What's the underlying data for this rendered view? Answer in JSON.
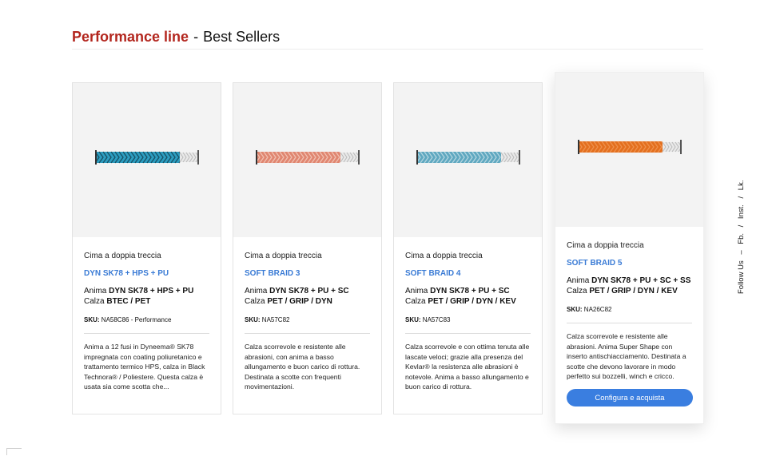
{
  "header": {
    "brand": "Performance line",
    "separator": "-",
    "subtitle": "Best Sellers"
  },
  "products": [
    {
      "type": "Cima a doppia treccia",
      "name": "DYN SK78 + HPS + PU",
      "core_label": "Anima",
      "core_value": "DYN SK78 + HPS + PU",
      "cover_label": "Calza",
      "cover_value": "BTEC / PET",
      "sku_label": "SKU:",
      "sku_value": "NA58C86 - Performance",
      "description": "Anima a 12 fusi in Dyneema® SK78 impregnata con coating poliuretanico e trattamento termico HPS, calza in Black Technora® / Poliestere. Questa calza è usata sia come scotta che...",
      "rope_color": "#2c9dc0",
      "rope_accent": "#0f2f3d"
    },
    {
      "type": "Cima a doppia treccia",
      "name": "SOFT BRAID 3",
      "core_label": "Anima",
      "core_value": "DYN SK78 + PU + SC",
      "cover_label": "Calza",
      "cover_value": "PET / GRIP / DYN",
      "sku_label": "SKU:",
      "sku_value": "NA57C82",
      "description": "Calza scorrevole e resistente alle abrasioni, con anima a basso allungamento e buon carico di rottura. Destinata a scotte con frequenti movimentazioni.",
      "rope_color": "#e08670",
      "rope_accent": "#f6d8cd"
    },
    {
      "type": "Cima a doppia treccia",
      "name": "SOFT BRAID 4",
      "core_label": "Anima",
      "core_value": "DYN SK78 + PU + SC",
      "cover_label": "Calza",
      "cover_value": "PET / GRIP / DYN / KEV",
      "sku_label": "SKU:",
      "sku_value": "NA57C83",
      "description": "Calza scorrevole e con ottima tenuta alle lascate veloci; grazie alla presenza del Kevlar® la resistenza alle abrasioni è notevole. Anima a basso allungamento e buon carico di rottura.",
      "rope_color": "#5fa8c0",
      "rope_accent": "#d7e8ee"
    },
    {
      "type": "Cima a doppia treccia",
      "name": "SOFT BRAID 5",
      "core_label": "Anima",
      "core_value": "DYN SK78 + PU + SC + SS",
      "cover_label": "Calza",
      "cover_value": "PET / GRIP / DYN / KEV",
      "sku_label": "SKU:",
      "sku_value": "NA26C82",
      "description": "Calza scorrevole e resistente alle abrasioni. Anima Super Shape con inserto antischiacciamento. Destinata a scotte che devono lavorare in modo perfetto sui bozzelli, winch e cricco.",
      "cta_label": "Configura e acquista",
      "rope_color": "#e36f1e",
      "rope_accent": "#f4a163"
    }
  ],
  "social": {
    "label": "Follow Us",
    "dash": "–",
    "fb": "Fb.",
    "inst": "Inst.",
    "lk": "Lk.",
    "slash": "/"
  }
}
